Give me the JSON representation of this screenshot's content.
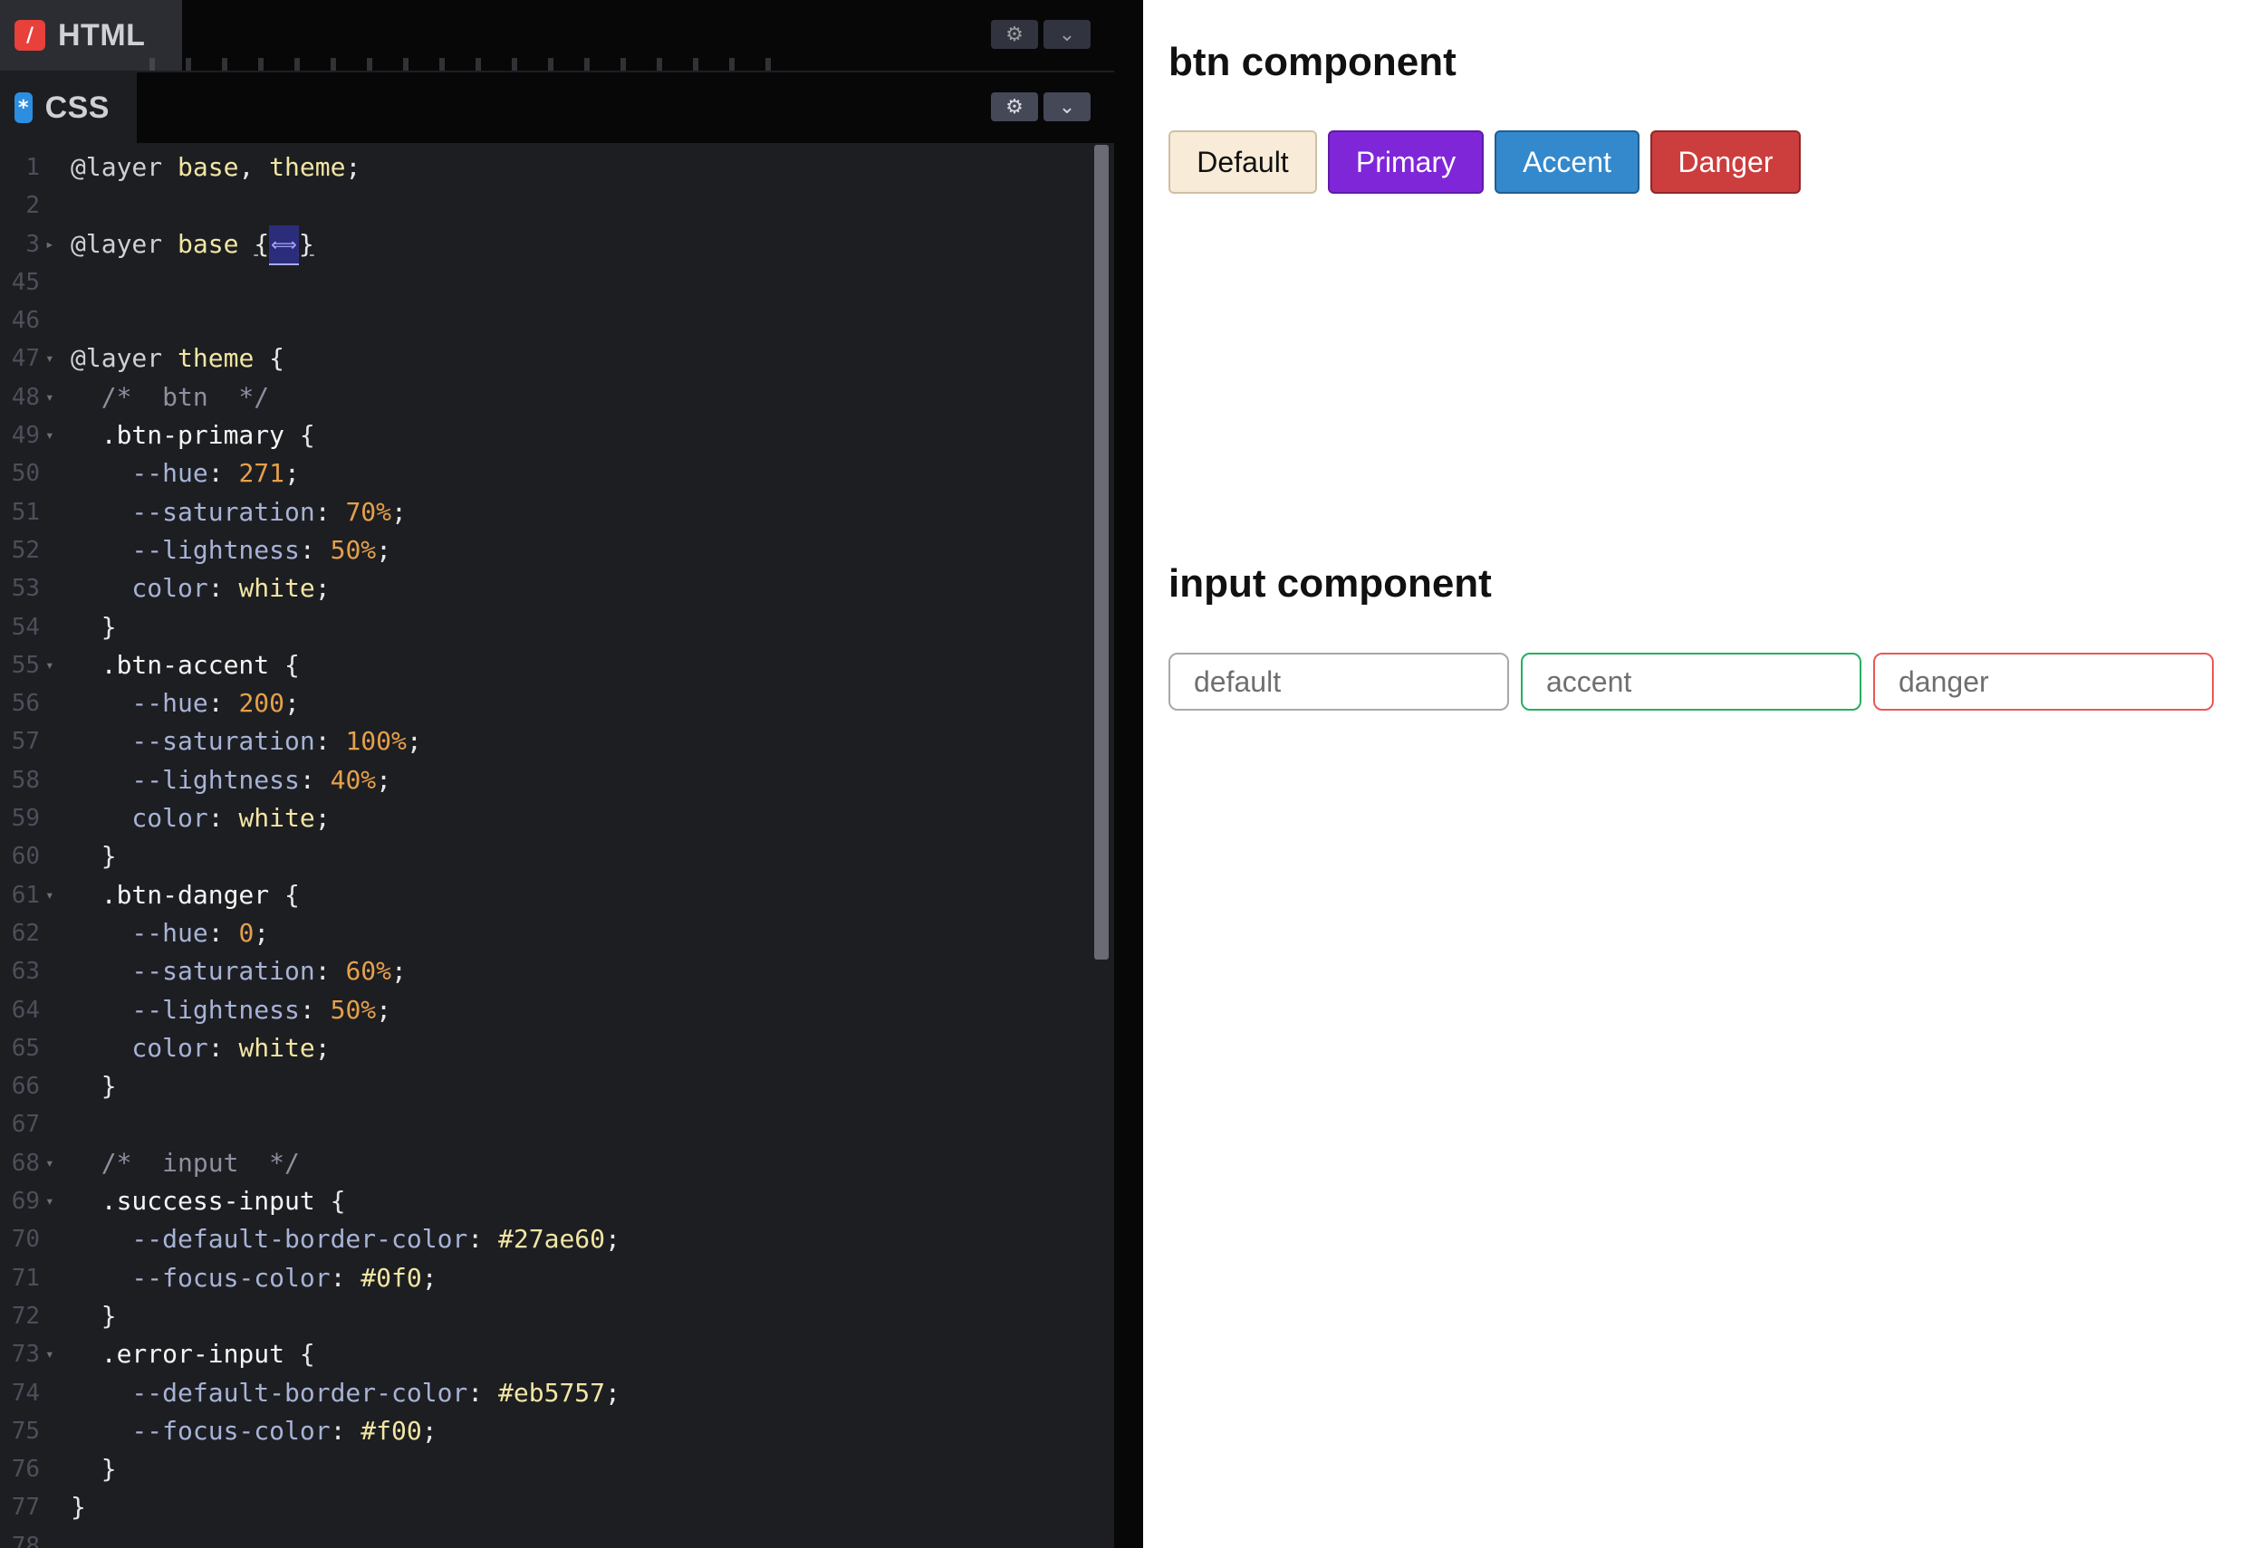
{
  "editor": {
    "html_tab": {
      "label": "HTML",
      "icon": "html-icon"
    },
    "css_tab": {
      "label": "CSS",
      "icon": "css-icon"
    },
    "settings_icon": "gear-icon",
    "collapse_icon": "chevron-down-icon",
    "fold_marker": "⟺",
    "code_lines": [
      {
        "n": "1",
        "fold": "",
        "tokens": [
          [
            "kw",
            "@layer "
          ],
          [
            "name",
            "base"
          ],
          [
            "punc",
            ", "
          ],
          [
            "name",
            "theme"
          ],
          [
            "punc",
            ";"
          ]
        ]
      },
      {
        "n": "2",
        "fold": "",
        "tokens": []
      },
      {
        "n": "3",
        "fold": "▸",
        "tokens": [
          [
            "kw",
            "@layer "
          ],
          [
            "name",
            "base"
          ],
          [
            "punc",
            " "
          ],
          [
            "brace",
            "{"
          ],
          [
            "marker",
            "⟺"
          ],
          [
            "brace",
            "}"
          ]
        ]
      },
      {
        "n": "45",
        "fold": "",
        "tokens": []
      },
      {
        "n": "46",
        "fold": "",
        "tokens": []
      },
      {
        "n": "47",
        "fold": "▾",
        "tokens": [
          [
            "kw",
            "@layer "
          ],
          [
            "name",
            "theme"
          ],
          [
            "punc",
            " {"
          ]
        ]
      },
      {
        "n": "48",
        "fold": "▾",
        "tokens": [
          [
            "cmt",
            "  /*  btn  */"
          ]
        ]
      },
      {
        "n": "49",
        "fold": "▾",
        "tokens": [
          [
            "sel",
            "  .btn-primary "
          ],
          [
            "punc",
            "{"
          ]
        ]
      },
      {
        "n": "50",
        "fold": "",
        "tokens": [
          [
            "prop",
            "    --hue"
          ],
          [
            "punc",
            ": "
          ],
          [
            "num",
            "271"
          ],
          [
            "punc",
            ";"
          ]
        ]
      },
      {
        "n": "51",
        "fold": "",
        "tokens": [
          [
            "prop",
            "    --saturation"
          ],
          [
            "punc",
            ": "
          ],
          [
            "num",
            "70%"
          ],
          [
            "punc",
            ";"
          ]
        ]
      },
      {
        "n": "52",
        "fold": "",
        "tokens": [
          [
            "prop",
            "    --lightness"
          ],
          [
            "punc",
            ": "
          ],
          [
            "num",
            "50%"
          ],
          [
            "punc",
            ";"
          ]
        ]
      },
      {
        "n": "53",
        "fold": "",
        "tokens": [
          [
            "prop",
            "    color"
          ],
          [
            "punc",
            ": "
          ],
          [
            "val",
            "white"
          ],
          [
            "punc",
            ";"
          ]
        ]
      },
      {
        "n": "54",
        "fold": "",
        "tokens": [
          [
            "punc",
            "  }"
          ]
        ]
      },
      {
        "n": "55",
        "fold": "▾",
        "tokens": [
          [
            "sel",
            "  .btn-accent "
          ],
          [
            "punc",
            "{"
          ]
        ]
      },
      {
        "n": "56",
        "fold": "",
        "tokens": [
          [
            "prop",
            "    --hue"
          ],
          [
            "punc",
            ": "
          ],
          [
            "num",
            "200"
          ],
          [
            "punc",
            ";"
          ]
        ]
      },
      {
        "n": "57",
        "fold": "",
        "tokens": [
          [
            "prop",
            "    --saturation"
          ],
          [
            "punc",
            ": "
          ],
          [
            "num",
            "100%"
          ],
          [
            "punc",
            ";"
          ]
        ]
      },
      {
        "n": "58",
        "fold": "",
        "tokens": [
          [
            "prop",
            "    --lightness"
          ],
          [
            "punc",
            ": "
          ],
          [
            "num",
            "40%"
          ],
          [
            "punc",
            ";"
          ]
        ]
      },
      {
        "n": "59",
        "fold": "",
        "tokens": [
          [
            "prop",
            "    color"
          ],
          [
            "punc",
            ": "
          ],
          [
            "val",
            "white"
          ],
          [
            "punc",
            ";"
          ]
        ]
      },
      {
        "n": "60",
        "fold": "",
        "tokens": [
          [
            "punc",
            "  }"
          ]
        ]
      },
      {
        "n": "61",
        "fold": "▾",
        "tokens": [
          [
            "sel",
            "  .btn-danger "
          ],
          [
            "punc",
            "{"
          ]
        ]
      },
      {
        "n": "62",
        "fold": "",
        "tokens": [
          [
            "prop",
            "    --hue"
          ],
          [
            "punc",
            ": "
          ],
          [
            "num",
            "0"
          ],
          [
            "punc",
            ";"
          ]
        ]
      },
      {
        "n": "63",
        "fold": "",
        "tokens": [
          [
            "prop",
            "    --saturation"
          ],
          [
            "punc",
            ": "
          ],
          [
            "num",
            "60%"
          ],
          [
            "punc",
            ";"
          ]
        ]
      },
      {
        "n": "64",
        "fold": "",
        "tokens": [
          [
            "prop",
            "    --lightness"
          ],
          [
            "punc",
            ": "
          ],
          [
            "num",
            "50%"
          ],
          [
            "punc",
            ";"
          ]
        ]
      },
      {
        "n": "65",
        "fold": "",
        "tokens": [
          [
            "prop",
            "    color"
          ],
          [
            "punc",
            ": "
          ],
          [
            "val",
            "white"
          ],
          [
            "punc",
            ";"
          ]
        ]
      },
      {
        "n": "66",
        "fold": "",
        "tokens": [
          [
            "punc",
            "  }"
          ]
        ]
      },
      {
        "n": "67",
        "fold": "",
        "tokens": []
      },
      {
        "n": "68",
        "fold": "▾",
        "tokens": [
          [
            "cmt",
            "  /*  input  */"
          ]
        ]
      },
      {
        "n": "69",
        "fold": "▾",
        "tokens": [
          [
            "sel",
            "  .success-input "
          ],
          [
            "punc",
            "{"
          ]
        ]
      },
      {
        "n": "70",
        "fold": "",
        "tokens": [
          [
            "prop",
            "    --default-border-color"
          ],
          [
            "punc",
            ": "
          ],
          [
            "val",
            "#27ae60"
          ],
          [
            "punc",
            ";"
          ]
        ]
      },
      {
        "n": "71",
        "fold": "",
        "tokens": [
          [
            "prop",
            "    --focus-color"
          ],
          [
            "punc",
            ": "
          ],
          [
            "val",
            "#0f0"
          ],
          [
            "punc",
            ";"
          ]
        ]
      },
      {
        "n": "72",
        "fold": "",
        "tokens": [
          [
            "punc",
            "  }"
          ]
        ]
      },
      {
        "n": "73",
        "fold": "▾",
        "tokens": [
          [
            "sel",
            "  .error-input "
          ],
          [
            "punc",
            "{"
          ]
        ]
      },
      {
        "n": "74",
        "fold": "",
        "tokens": [
          [
            "prop",
            "    --default-border-color"
          ],
          [
            "punc",
            ": "
          ],
          [
            "val",
            "#eb5757"
          ],
          [
            "punc",
            ";"
          ]
        ]
      },
      {
        "n": "75",
        "fold": "",
        "tokens": [
          [
            "prop",
            "    --focus-color"
          ],
          [
            "punc",
            ": "
          ],
          [
            "val",
            "#f00"
          ],
          [
            "punc",
            ";"
          ]
        ]
      },
      {
        "n": "76",
        "fold": "",
        "tokens": [
          [
            "punc",
            "  }"
          ]
        ]
      },
      {
        "n": "77",
        "fold": "",
        "tokens": [
          [
            "punc",
            "}"
          ]
        ]
      },
      {
        "n": "78",
        "fold": "",
        "tokens": []
      }
    ]
  },
  "preview": {
    "btn_title": "btn component",
    "buttons": {
      "default": "Default",
      "primary": "Primary",
      "accent": "Accent",
      "danger": "Danger"
    },
    "input_title": "input component",
    "inputs": {
      "default": "default",
      "accent": "accent",
      "danger": "danger"
    }
  },
  "colors": {
    "primary": "#8026d9",
    "accent": "#3389cc",
    "danger": "#cc3d3d",
    "success_border": "#27ae60",
    "error_border": "#eb5757"
  }
}
